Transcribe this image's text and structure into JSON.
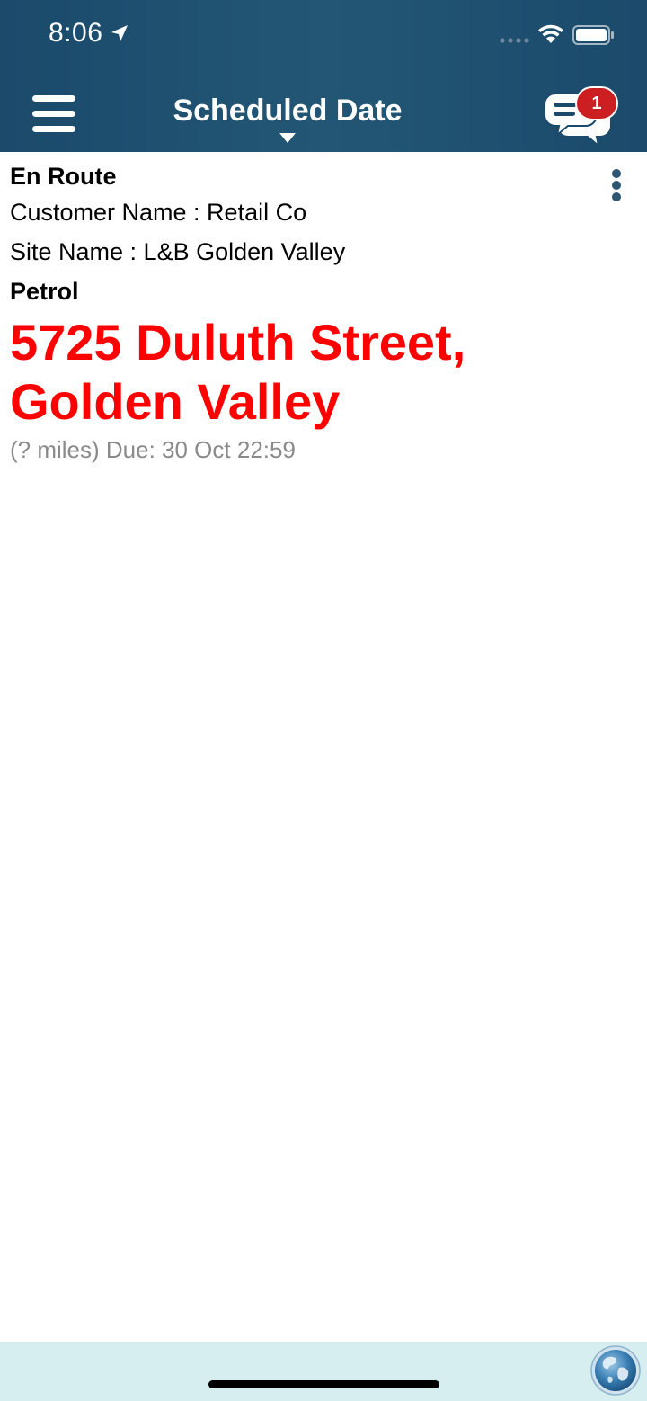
{
  "status_bar": {
    "time": "8:06"
  },
  "header": {
    "title": "Scheduled Date",
    "unread_count": "1"
  },
  "job": {
    "status": "En Route",
    "customer_line": "Customer Name : Retail Co",
    "site_line": "Site Name : L&B Golden Valley",
    "product": "Petrol",
    "address_line1": "5725 Duluth Street,",
    "address_line2": "Golden Valley",
    "due_line": "(? miles) Due: 30 Oct 22:59"
  },
  "colors": {
    "header_bg": "#1b4a6b",
    "address_red": "#ff0000",
    "badge_red": "#cc1f22",
    "footer_bg": "#d7eef0"
  },
  "icons": {
    "menu": "hamburger-icon",
    "chat": "chat-bubbles-icon",
    "more": "kebab-icon",
    "globe": "globe-icon"
  }
}
